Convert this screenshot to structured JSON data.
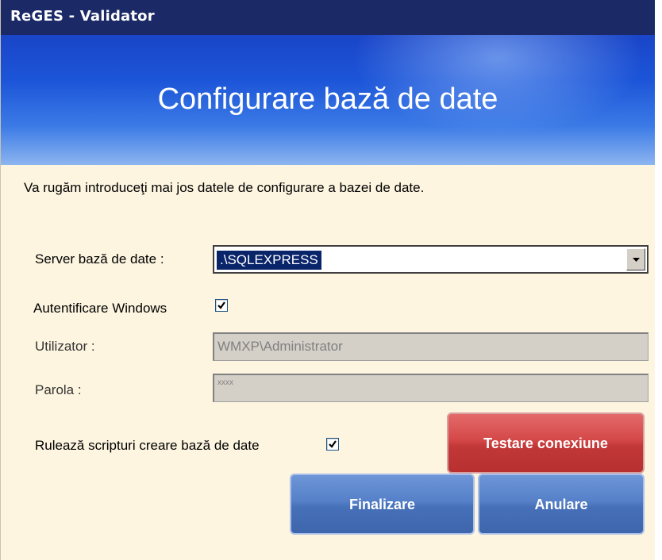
{
  "window": {
    "title": "ReGES - Validator"
  },
  "banner": {
    "heading": "Configurare bază de date"
  },
  "instructions": "Va rugăm introduceţi mai jos datele de configurare a bazei de date.",
  "server": {
    "label": "Server bază de date  :",
    "value": ".\\SQLEXPRESS"
  },
  "windows_auth": {
    "label": "Autentificare Windows",
    "checked": true
  },
  "user": {
    "label": "Utilizator :",
    "value": "WMXP\\Administrator"
  },
  "password": {
    "label": "Parola :",
    "value": "xxxx"
  },
  "run_scripts": {
    "label": "Rulează scripturi creare bază de date",
    "checked": true
  },
  "buttons": {
    "test": "Testare conexiune",
    "finish": "Finalizare",
    "cancel": "Anulare"
  },
  "colors": {
    "titlebar": "#1b2a66",
    "background": "#fdf5e0",
    "test_button": "#c23838",
    "primary_button": "#4670b8",
    "selection": "#0a246a"
  }
}
